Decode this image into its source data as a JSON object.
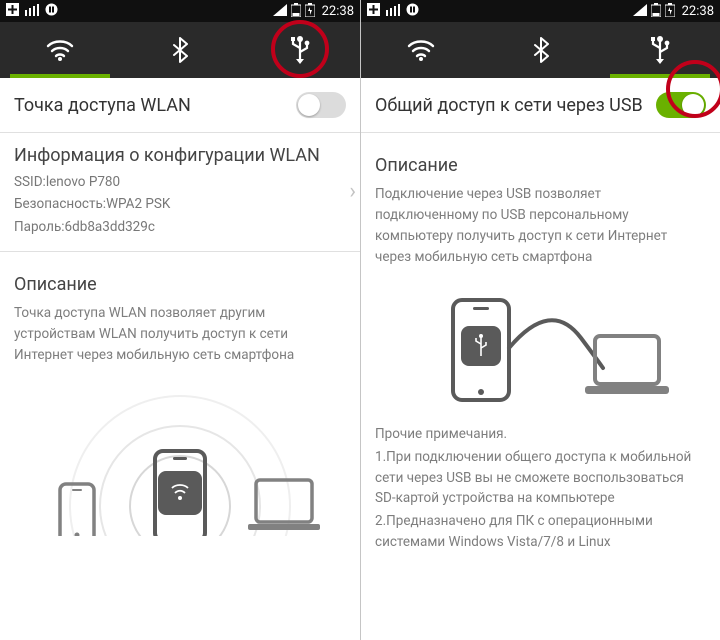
{
  "time": "22:38",
  "left": {
    "title": "Точка доступа WLAN",
    "toggle": false,
    "config_title": "Информация о конфигурации WLAN",
    "ssid_line": "SSID:lenovo P780",
    "sec_line": "Безопасность:WPA2 PSK",
    "pass_line": "Пароль:6db8a3dd329c",
    "desc_head": "Описание",
    "desc_body": "Точка доступа WLAN позволяет другим устройствам WLAN получить доступ к сети Интернет через мобильную сеть смартфона"
  },
  "right": {
    "title": "Общий доступ к сети через USB",
    "toggle": true,
    "desc_head": "Описание",
    "desc_body": "Подключение через USB позволяет подключенному по USB персональному компьютеру получить доступ к сети Интернет через мобильную сеть смартфона",
    "notes_head": "Прочие примечания.",
    "note1": "1.При подключении общего доступа к мобильной сети через USB вы не сможете воспользоваться SD-картой устройства на компьютере",
    "note2": "2.Предназначено для ПК с операционными системами Windows Vista/7/8 и Linux"
  }
}
